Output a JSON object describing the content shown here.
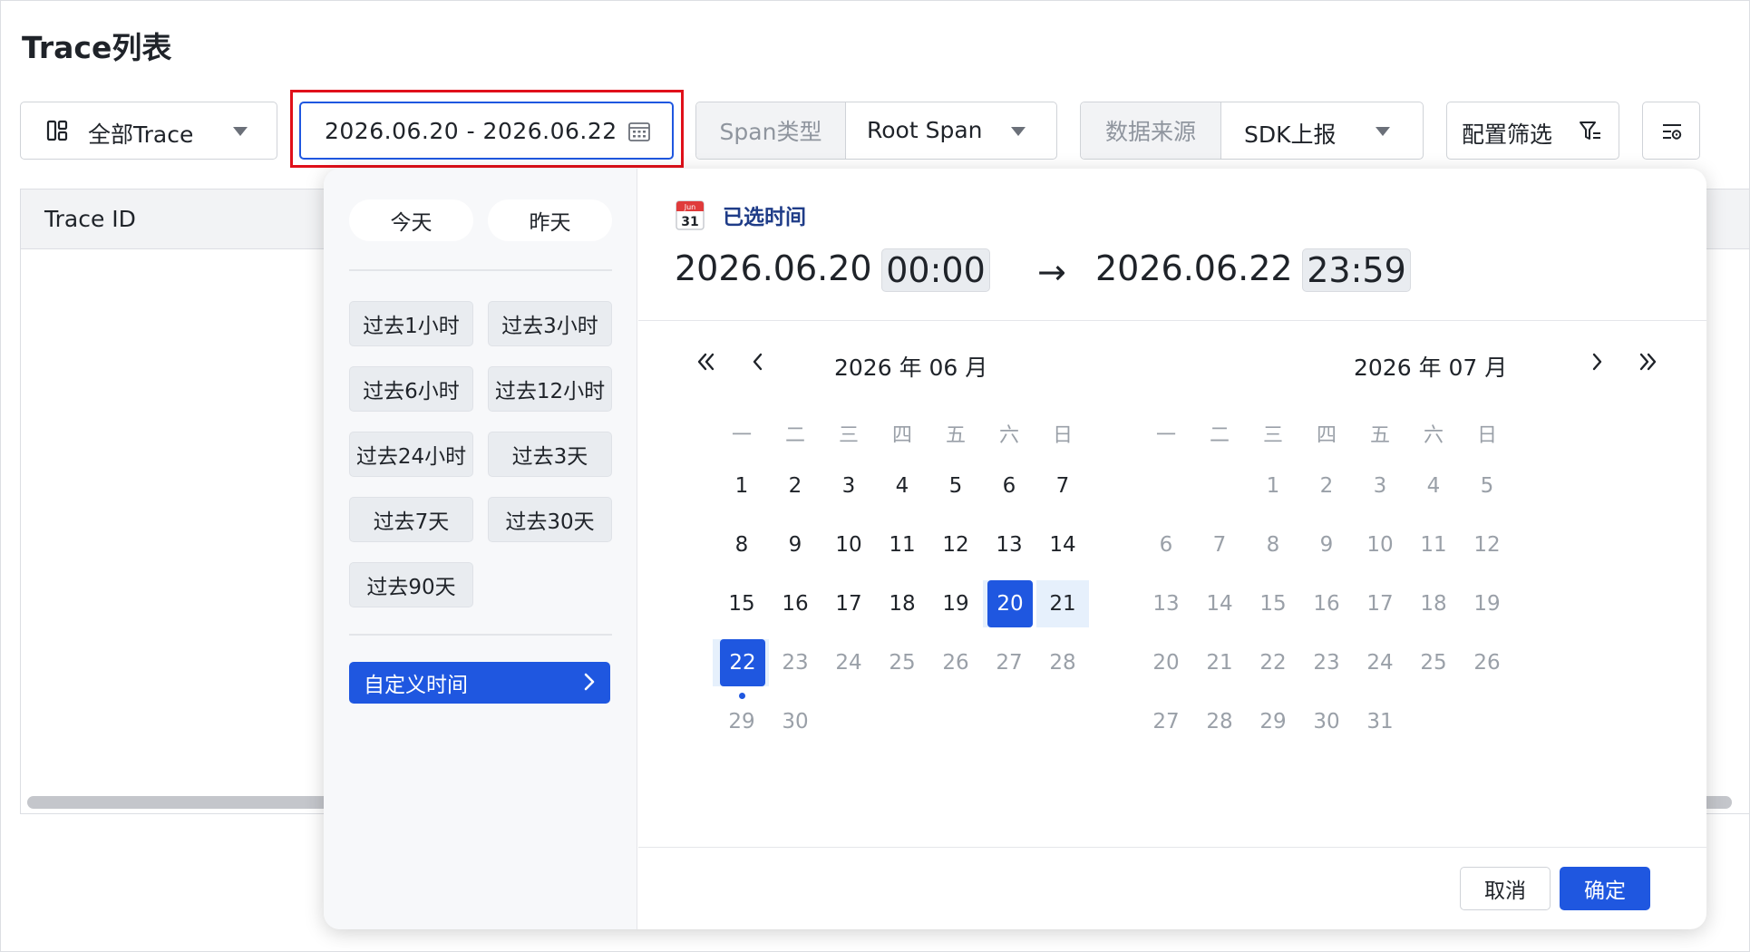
{
  "page": {
    "title": "Trace列表"
  },
  "filters": {
    "trace_scope": "全部Trace",
    "date_range": "2026.06.20 - 2026.06.22",
    "span_type_label": "Span类型",
    "span_type_value": "Root Span",
    "data_source_label": "数据来源",
    "data_source_value": "SDK上报",
    "config_filter": "配置筛选"
  },
  "table": {
    "columns": [
      "Trace ID"
    ]
  },
  "picker": {
    "quick": [
      "今天",
      "昨天"
    ],
    "ranges": [
      "过去1小时",
      "过去3小时",
      "过去6小时",
      "过去12小时",
      "过去24小时",
      "过去3天",
      "过去7天",
      "过去30天",
      "过去90天"
    ],
    "custom": "自定义时间",
    "selected_label": "已选时间",
    "mini_calendar": {
      "month": "Jun",
      "day": "31"
    },
    "start_date": "2026.06.20",
    "start_time": "00:00",
    "arrow": "→",
    "end_date": "2026.06.22",
    "end_time": "23:59",
    "weekdays": [
      "一",
      "二",
      "三",
      "四",
      "五",
      "六",
      "日"
    ],
    "left_month": {
      "title": "2026 年 06 月",
      "days": [
        "1",
        "2",
        "3",
        "4",
        "5",
        "6",
        "7",
        "8",
        "9",
        "10",
        "11",
        "12",
        "13",
        "14",
        "15",
        "16",
        "17",
        "18",
        "19",
        "20",
        "21",
        "22",
        "23",
        "24",
        "25",
        "26",
        "27",
        "28",
        "29",
        "30"
      ],
      "range_start": "20",
      "range_middle": "21",
      "range_end": "22",
      "today": "22"
    },
    "right_month": {
      "title": "2026 年 07 月",
      "days": [
        "1",
        "2",
        "3",
        "4",
        "5",
        "6",
        "7",
        "8",
        "9",
        "10",
        "11",
        "12",
        "13",
        "14",
        "15",
        "16",
        "17",
        "18",
        "19",
        "20",
        "21",
        "22",
        "23",
        "24",
        "25",
        "26",
        "27",
        "28",
        "29",
        "30",
        "31"
      ]
    },
    "cancel": "取消",
    "confirm": "确定"
  },
  "colors": {
    "primary": "#1f57e0",
    "highlight_border": "#e0101a",
    "range_bg": "#e6f0fc"
  }
}
